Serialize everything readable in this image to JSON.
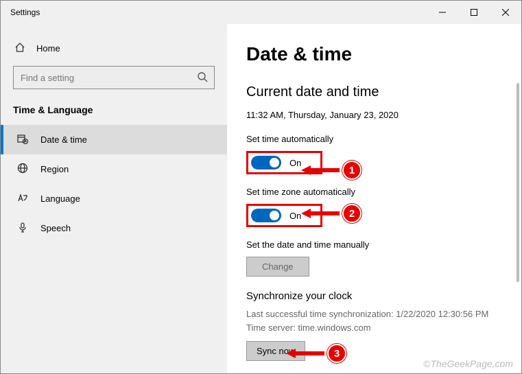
{
  "window": {
    "title": "Settings"
  },
  "sidebar": {
    "home": "Home",
    "search_placeholder": "Find a setting",
    "category": "Time & Language",
    "items": [
      {
        "label": "Date & time"
      },
      {
        "label": "Region"
      },
      {
        "label": "Language"
      },
      {
        "label": "Speech"
      }
    ]
  },
  "main": {
    "title": "Date & time",
    "subtitle": "Current date and time",
    "datetime": "11:32 AM, Thursday, January 23, 2020",
    "auto_time_label": "Set time automatically",
    "auto_time_state": "On",
    "auto_zone_label": "Set time zone automatically",
    "auto_zone_state": "On",
    "manual_label": "Set the date and time manually",
    "change_btn": "Change",
    "sync_head": "Synchronize your clock",
    "sync_last": "Last successful time synchronization: 1/22/2020 12:30:56 PM",
    "sync_server": "Time server: time.windows.com",
    "sync_btn": "Sync now"
  },
  "annotations": {
    "n1": "1",
    "n2": "2",
    "n3": "3"
  },
  "watermark": "©TheGeekPage.com"
}
